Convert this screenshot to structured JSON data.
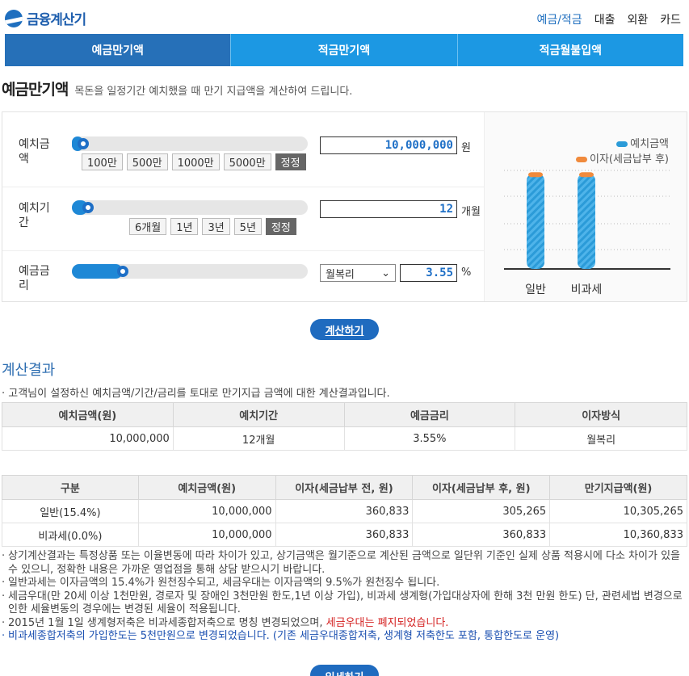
{
  "brand": {
    "name": "금융계산기"
  },
  "topnav": [
    {
      "label": "예금/적금",
      "active": true
    },
    {
      "label": "대출"
    },
    {
      "label": "외환"
    },
    {
      "label": "카드"
    }
  ],
  "tabs": [
    {
      "label": "예금만기액",
      "active": true
    },
    {
      "label": "적금만기액"
    },
    {
      "label": "적금월불입액"
    }
  ],
  "page": {
    "title": "예금만기액",
    "desc": "목돈을 일정기간 예치했을 때 만기 지급액을 계산하여 드립니다."
  },
  "form": {
    "deposit": {
      "label": "예치금액",
      "chips": [
        "100만",
        "500만",
        "1000만",
        "5000만",
        "정정"
      ],
      "value": "10,000,000",
      "unit": "원",
      "slider_level": 0.02
    },
    "period": {
      "label": "예치기간",
      "chips": [
        "6개월",
        "1년",
        "3년",
        "5년",
        "정정"
      ],
      "value": "12",
      "unit": "개월",
      "slider_level": 0.04
    },
    "rate": {
      "label": "예금금리",
      "select": "월복리",
      "value": "3.55",
      "unit": "%",
      "slider_level": 0.19
    }
  },
  "chart": {
    "legend": [
      "예치금액",
      "이자(세금납부 후)"
    ],
    "categories": [
      "일반",
      "비과세"
    ],
    "colors": {
      "principal": "#2b9bd8",
      "interest": "#f08a3c"
    }
  },
  "chart_data": {
    "type": "bar",
    "categories": [
      "일반",
      "비과세"
    ],
    "series": [
      {
        "name": "예치금액",
        "values": [
          10000000,
          10000000
        ]
      },
      {
        "name": "이자(세금납부 후)",
        "values": [
          305265,
          360833
        ]
      }
    ],
    "stacked": true,
    "legend": "top-right"
  },
  "actions": {
    "calculate": "계산하기",
    "detail": "일세하기"
  },
  "result": {
    "title": "계산결과",
    "desc": "고객님이 설정하신 예치금액/기간/금리를 토대로 만기지급 금액에 대한 계산결과입니다.",
    "summary_headers": [
      "예치금액(원)",
      "예치기간",
      "예금금리",
      "이자방식"
    ],
    "summary_row": [
      "10,000,000",
      "12개월",
      "3.55%",
      "월복리"
    ],
    "detail_headers": [
      "구분",
      "예치금액(원)",
      "이자(세금납부 전, 원)",
      "이자(세금납부 후, 원)",
      "만기지급액(원)"
    ],
    "detail_rows": [
      [
        "일반(15.4%)",
        "10,000,000",
        "360,833",
        "305,265",
        "10,305,265"
      ],
      [
        "비과세(0.0%)",
        "10,000,000",
        "360,833",
        "360,833",
        "10,360,833"
      ]
    ]
  },
  "notes": {
    "n1": "상기계산결과는 특정상품 또는 이율변동에 따라 차이가 있고, 상기금액은 월기준으로 계산된 금액으로 일단위 기준인 실제 상품 적용시에 다소 차이가 있을 수 있으니, 정확한 내용은 가까운 영업점을 통해 상담 받으시기 바랍니다.",
    "n2": "일반과세는 이자금액의 15.4%가 원천징수되고, 세금우대는 이자금액의 9.5%가 원천징수 됩니다.",
    "n3": "세금우대(만 20세 이상 1천만원, 경로자 및 장애인 3천만원 한도,1년 이상 가입), 비과세 생계형(가입대상자에 한해 3천 만원 한도) 단, 관련세법 변경으로 인한 세율변동의 경우에는 변경된 세율이 적용됩니다.",
    "n4a": "2015년 1월 1일 생계형저축은 비과세종합저축으로 명칭 변경되었으며, ",
    "n4b": "세금우대는 폐지되었습니다.",
    "n5": "비과세종합저축의 가입한도는 5천만원으로 변경되었습니다. (기존 세금우대종합저축, 생계형 저축한도 포함, 통합한도로 운영)"
  }
}
